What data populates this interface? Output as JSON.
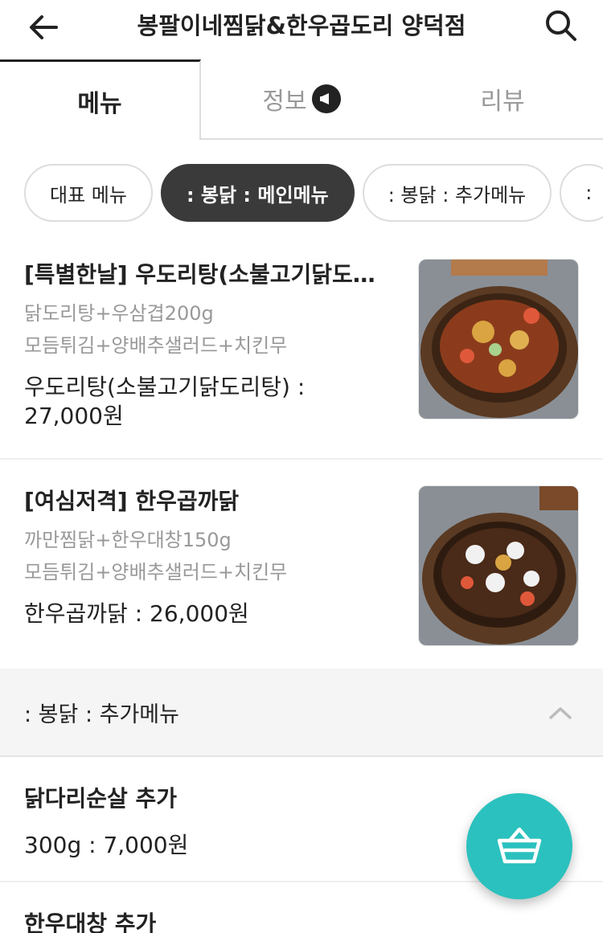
{
  "header": {
    "title": "봉팔이네찜닭&한우곱도리 양덕점",
    "back_icon": "arrow-left-icon",
    "search_icon": "search-icon"
  },
  "tabs": [
    {
      "label": "메뉴",
      "active": true
    },
    {
      "label": "정보",
      "active": false,
      "badge_icon": "megaphone-icon"
    },
    {
      "label": "리뷰",
      "active": false
    }
  ],
  "chips": [
    {
      "label": "대표 메뉴",
      "active": false
    },
    {
      "label": ": 봉닭 : 메인메뉴",
      "active": true
    },
    {
      "label": ": 봉닭 : 추가메뉴",
      "active": false
    },
    {
      "label": ":",
      "active": false
    }
  ],
  "menu_items": [
    {
      "name": "[특별한날] 우도리탕(소불고기닭도리탕)",
      "desc1": "닭도리탕+우삼겹200g",
      "desc2": "모듬튀김+양배추샐러드+치킨무",
      "price": "우도리탕(소불고기닭도리탕) : 27,000원"
    },
    {
      "name": "[여심저격] 한우곱까닭",
      "desc1": "까만찜닭+한우대창150g",
      "desc2": "모듬튀김+양배추샐러드+치킨무",
      "price": "한우곱까닭 : 26,000원"
    }
  ],
  "section": {
    "label": ": 봉닭 : 추가메뉴",
    "chevron_icon": "chevron-up-icon"
  },
  "options": [
    {
      "name": "닭다리순살 추가",
      "price": "300g : 7,000원"
    },
    {
      "name": "한우대창 추가",
      "price": ""
    }
  ],
  "cart": {
    "icon": "basket-icon",
    "color": "#2bc1be"
  }
}
